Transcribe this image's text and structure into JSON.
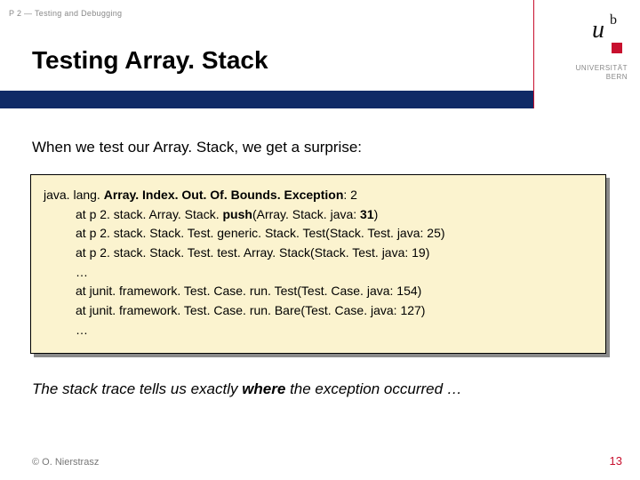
{
  "header": {
    "crumb": "P 2 — Testing and Debugging",
    "title": "Testing Array. Stack"
  },
  "logo": {
    "u": "u",
    "b": "b",
    "uni": "UNIVERSITÄT",
    "bern": "BERN"
  },
  "body": {
    "intro": "When we test our Array. Stack, we get a surprise:",
    "concl_pre": "The stack trace tells us exactly ",
    "concl_bold": "where",
    "concl_post": " the exception occurred …"
  },
  "trace": {
    "l1a": "java. lang. ",
    "l1b": "Array. Index. Out. Of. Bounds. Exception",
    "l1c": ": 2",
    "l2a": "at p 2. stack. Array. Stack. ",
    "l2b": "push",
    "l2c": "(Array. Stack. java: ",
    "l2d": "31",
    "l2e": ")",
    "l3": "at p 2. stack. Stack. Test. generic. Stack. Test(Stack. Test. java: 25)",
    "l4": "at p 2. stack. Stack. Test. test. Array. Stack(Stack. Test. java: 19)",
    "l5": "…",
    "l6": "at junit. framework. Test. Case. run. Test(Test. Case. java: 154)",
    "l7": "at junit. framework. Test. Case. run. Bare(Test. Case. java: 127)",
    "l8": "…"
  },
  "footer": {
    "copyright": "© O. Nierstrasz",
    "pagenum": "13"
  }
}
